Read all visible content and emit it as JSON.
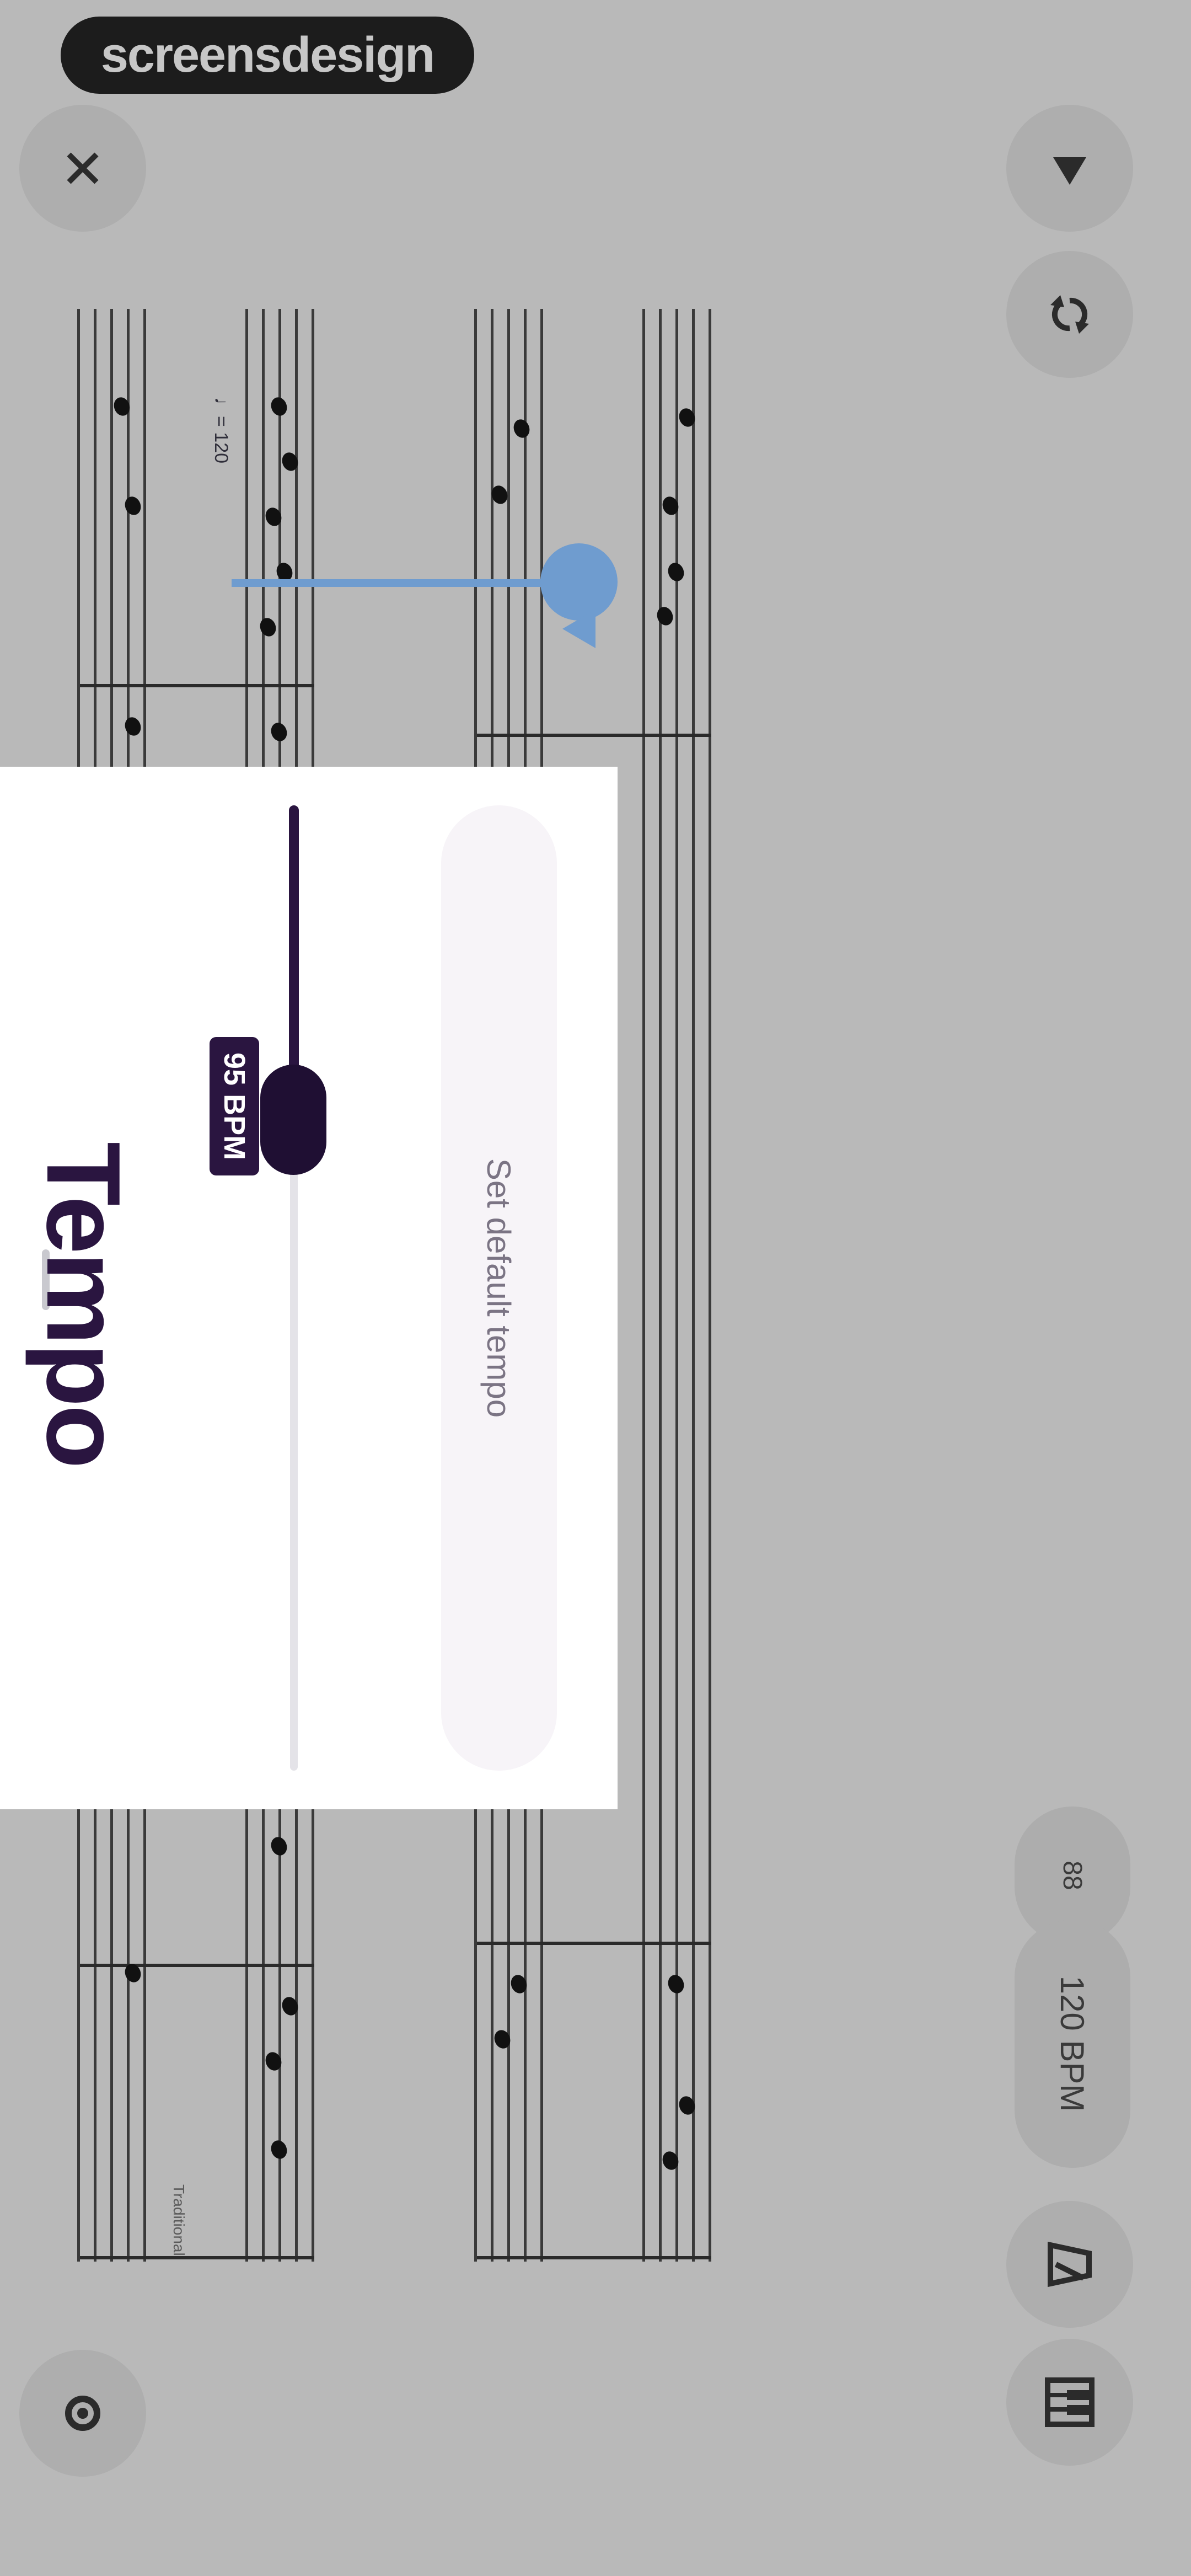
{
  "brand": {
    "logo_text": "screensdesign"
  },
  "toolbar": {
    "close_icon": "close-icon",
    "play_icon": "play-icon",
    "loop_icon": "loop-icon",
    "metronome_icon": "metronome-icon",
    "piano_icon": "piano-icon",
    "settings_icon": "gear-icon",
    "tempo_pill_label": "120 BPM",
    "left_pill_label": "88"
  },
  "score": {
    "tempo_marking": "♩= 120",
    "composer_marking": "Traditional"
  },
  "playback": {
    "progress": 0.02
  },
  "tempo_panel": {
    "title": "Tempo",
    "badge": "95 BPM",
    "slider_value": 95,
    "set_default_label": "Set default tempo"
  },
  "colors": {
    "overlay": "#b9b9b9",
    "accent": "#2a1540",
    "playhead": "#6f9ccf",
    "panel_bg": "#ffffff"
  }
}
